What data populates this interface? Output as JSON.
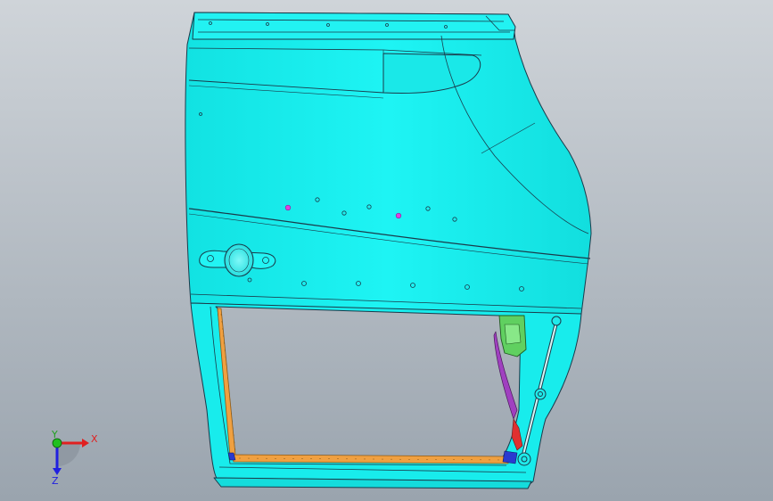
{
  "viewport": {
    "background_top": "#cfd4d9",
    "background_bottom": "#9aa4ae",
    "model": {
      "body_color": "#19f0f0",
      "outline_color": "#1a3a4a",
      "frame_color": "#f0a040",
      "bracket_color": "#60d060",
      "accent_purple": "#a040c0",
      "hole_color": "#e040e0"
    },
    "triad": {
      "x_label": "X",
      "y_label": "Y",
      "z_label": "Z",
      "x_color": "#e02020",
      "y_color": "#20c020",
      "z_color": "#2020e0"
    }
  }
}
